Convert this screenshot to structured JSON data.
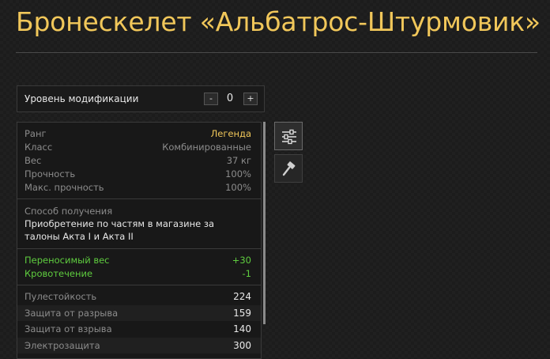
{
  "item": {
    "title": "Бронескелет «Альбатрос-Штурмовик»"
  },
  "modification": {
    "label": "Уровень модификации",
    "minus": "-",
    "plus": "+",
    "value": "0"
  },
  "info": {
    "rows": [
      {
        "label": "Ранг",
        "value": "Легенда"
      },
      {
        "label": "Класс",
        "value": "Комбинированные"
      },
      {
        "label": "Вес",
        "value": "37 кг"
      },
      {
        "label": "Прочность",
        "value": "100%"
      },
      {
        "label": "Макс. прочность",
        "value": "100%"
      }
    ]
  },
  "acquisition": {
    "title": "Способ получения",
    "text": "Приобретение по частям в магазине за талоны Акта I и Акта II"
  },
  "bonuses": [
    {
      "label": "Переносимый вес",
      "value": "+30"
    },
    {
      "label": "Кровотечение",
      "value": "-1"
    }
  ],
  "stats": [
    {
      "label": "Пулестойкость",
      "value": "224"
    },
    {
      "label": "Защита от разрыва",
      "value": "159"
    },
    {
      "label": "Защита от взрыва",
      "value": "140"
    },
    {
      "label": "Электрозащита",
      "value": "300"
    }
  ],
  "colors": {
    "accent_gold": "#f1c75a",
    "bonus_green": "#5fcd3f",
    "background": "#1c1c1c"
  },
  "side_buttons": [
    {
      "icon": "sliders-icon",
      "active": true
    },
    {
      "icon": "hammer-icon",
      "active": false
    }
  ]
}
